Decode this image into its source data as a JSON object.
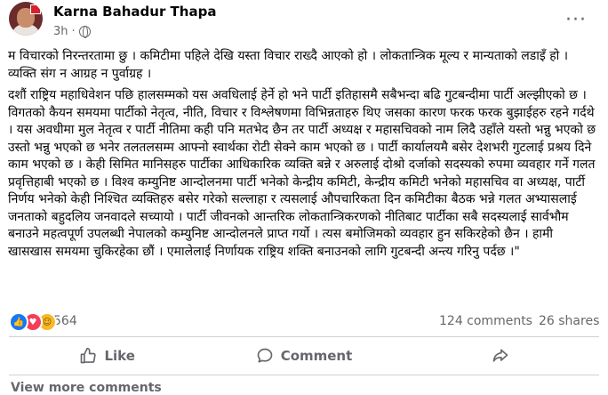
{
  "post": {
    "author": "Karna Bahadur Thapa",
    "time": "3h",
    "dot": "·",
    "paragraph1": "म विचारको निरन्तरतामा छु । कमिटीमा पहिले देखि यस्ता विचार राख्दै आएको हो । लोकतान्त्रिक मूल्य र मान्यताको लडाइँ हो । व्यक्ति संग न आग्रह न पुर्वाग्रह ।",
    "paragraph2": "दशौं राष्ट्रिय महाधिवेशन पछि हालसम्मको यस अवधिलाई हेर्ने हो भने पार्टी इतिहासमै सबैभन्दा बढि गुटबन्दीमा पार्टी अल्झीएको छ । विगतको कैयन समयमा पार्टीको नेतृत्व, नीति, विचार र विश्लेषणमा विभिन्नताहरु थिए जसका कारण फरक फरक बुझाईहरु रहने गर्दथे । यस अवधीमा मुल नेतृत्व र पार्टी नीतिमा कही पनि मतभेद छैन तर पार्टी अध्यक्ष र महासचिवको नाम लिदै उहाँले यस्तो भन्नु भएको छ उस्तो भन्नु भएको छ भनेर तलतलसम्म आफ्नो स्वार्थका रोटी सेक्ने काम भएको छ । पार्टी कार्यालयमै बसेर देशभरी गुटलाई प्रश्रय दिने काम भएको छ । केही सिमित मानिसहरु पार्टीका आधिकारिक व्यक्ति बन्ने र अरुलाई दोश्रो दर्जाको सदस्यको रुपमा व्यवहार गर्ने गलत प्रवृत्तिहाबी भएको छ । विश्व कम्युनिष्ट आन्दोलनमा पार्टी भनेको केन्द्रीय कमिटी, केन्द्रीय कमिटी भनेको महासचिव वा अध्यक्ष, पार्टी निर्णय भनेको केही निश्चित व्यक्तिहरु बसेर गरेको सल्लाहा र त्यसलाई औपचारिकता दिन कमिटीका बैठक भन्ने गलत अभ्यासलाई जनताको बहुदलिय जनवादले सच्यायो । पार्टी जीवनको आन्तरिक लोकतान्त्रिकरणको नीतिबाट पार्टीका सबै सदस्यलाई सार्वभौम बनाउने महत्वपूर्ण उपलब्धी नेपालको कम्युनिष्ट आन्दोलनले प्राप्त गर्यो । त्यस बमोजिमको व्यवहार हुन सकिरहेको छैन । हामी खासखास समयमा चुकिरहेका छौं । एमालेलाई निर्णायक राष्ट्रिय शक्ति बनाउनको लागि गुटबन्दी अन्त्य गरिनु पर्दछ ।\""
  },
  "stats": {
    "reactions_count": "564",
    "comments": "124 comments",
    "shares": "26 shares"
  },
  "actions": {
    "like": "Like",
    "comment": "Comment"
  },
  "footer": {
    "view_more": "View more comments"
  },
  "colors": {
    "like_blue": "#1877f2",
    "love_red": "#f33e58",
    "care_yellow": "#f7b928",
    "secondary_text": "#65676b"
  }
}
